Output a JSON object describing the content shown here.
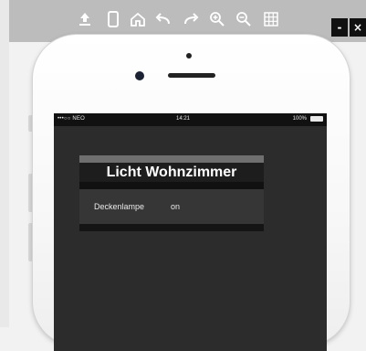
{
  "toolbar": {
    "icons": [
      "upload-icon",
      "phone-icon",
      "home-icon",
      "undo-icon",
      "redo-icon",
      "zoom-in-icon",
      "zoom-out-icon",
      "grid-icon"
    ]
  },
  "window_buttons": {
    "minimize": "-",
    "close": "×"
  },
  "status_bar": {
    "carrier": "•••○○ NEO",
    "time": "14:21",
    "battery": "100%"
  },
  "panel": {
    "title": "Licht Wohnzimmer",
    "rows": [
      {
        "label": "Deckenlampe",
        "value": "on"
      }
    ]
  }
}
